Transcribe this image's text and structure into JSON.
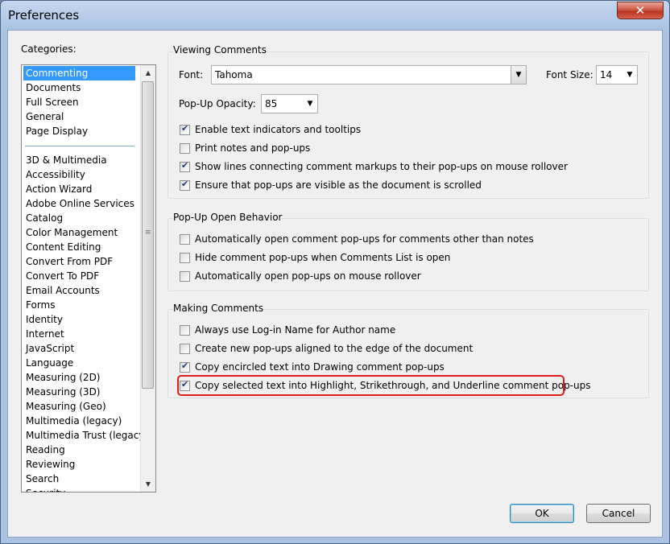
{
  "window": {
    "title": "Preferences",
    "close_glyph": "✕"
  },
  "categories": {
    "label": "Categories:",
    "group1": [
      "Commenting",
      "Documents",
      "Full Screen",
      "General",
      "Page Display"
    ],
    "group2": [
      "3D & Multimedia",
      "Accessibility",
      "Action Wizard",
      "Adobe Online Services",
      "Catalog",
      "Color Management",
      "Content Editing",
      "Convert From PDF",
      "Convert To PDF",
      "Email Accounts",
      "Forms",
      "Identity",
      "Internet",
      "JavaScript",
      "Language",
      "Measuring (2D)",
      "Measuring (3D)",
      "Measuring (Geo)",
      "Multimedia (legacy)",
      "Multimedia Trust (legacy)",
      "Reading",
      "Reviewing",
      "Search",
      "Security"
    ],
    "selected": "Commenting"
  },
  "viewing": {
    "title": "Viewing Comments",
    "font_label": "Font:",
    "font_value": "Tahoma",
    "fontsize_label": "Font Size:",
    "fontsize_value": "14",
    "opacity_label": "Pop-Up Opacity:",
    "opacity_value": "85",
    "checks": [
      {
        "label": "Enable text indicators and tooltips",
        "checked": true
      },
      {
        "label": "Print notes and pop-ups",
        "checked": false
      },
      {
        "label": "Show lines connecting comment markups to their pop-ups on mouse rollover",
        "checked": true
      },
      {
        "label": "Ensure that pop-ups are visible as the document is scrolled",
        "checked": true
      }
    ]
  },
  "popup": {
    "title": "Pop-Up Open Behavior",
    "checks": [
      {
        "label": "Automatically open comment pop-ups for comments other than notes",
        "checked": false
      },
      {
        "label": "Hide comment pop-ups when Comments List is open",
        "checked": false
      },
      {
        "label": "Automatically open pop-ups on mouse rollover",
        "checked": false
      }
    ]
  },
  "making": {
    "title": "Making Comments",
    "checks": [
      {
        "label": "Always use Log-in Name for Author name",
        "checked": false
      },
      {
        "label": "Create new pop-ups aligned to the edge of the document",
        "checked": false
      },
      {
        "label": "Copy encircled text into Drawing comment pop-ups",
        "checked": true
      },
      {
        "label": "Copy selected text into Highlight, Strikethrough, and Underline comment pop-ups",
        "checked": true
      }
    ]
  },
  "buttons": {
    "ok": "OK",
    "cancel": "Cancel"
  },
  "colors": {
    "selection": "#3399ff",
    "highlight_border": "#e01b1b"
  },
  "icons": {
    "dropdown": "chevron-down-icon",
    "scroll_up": "scroll-up-icon",
    "scroll_down": "scroll-down-icon"
  }
}
